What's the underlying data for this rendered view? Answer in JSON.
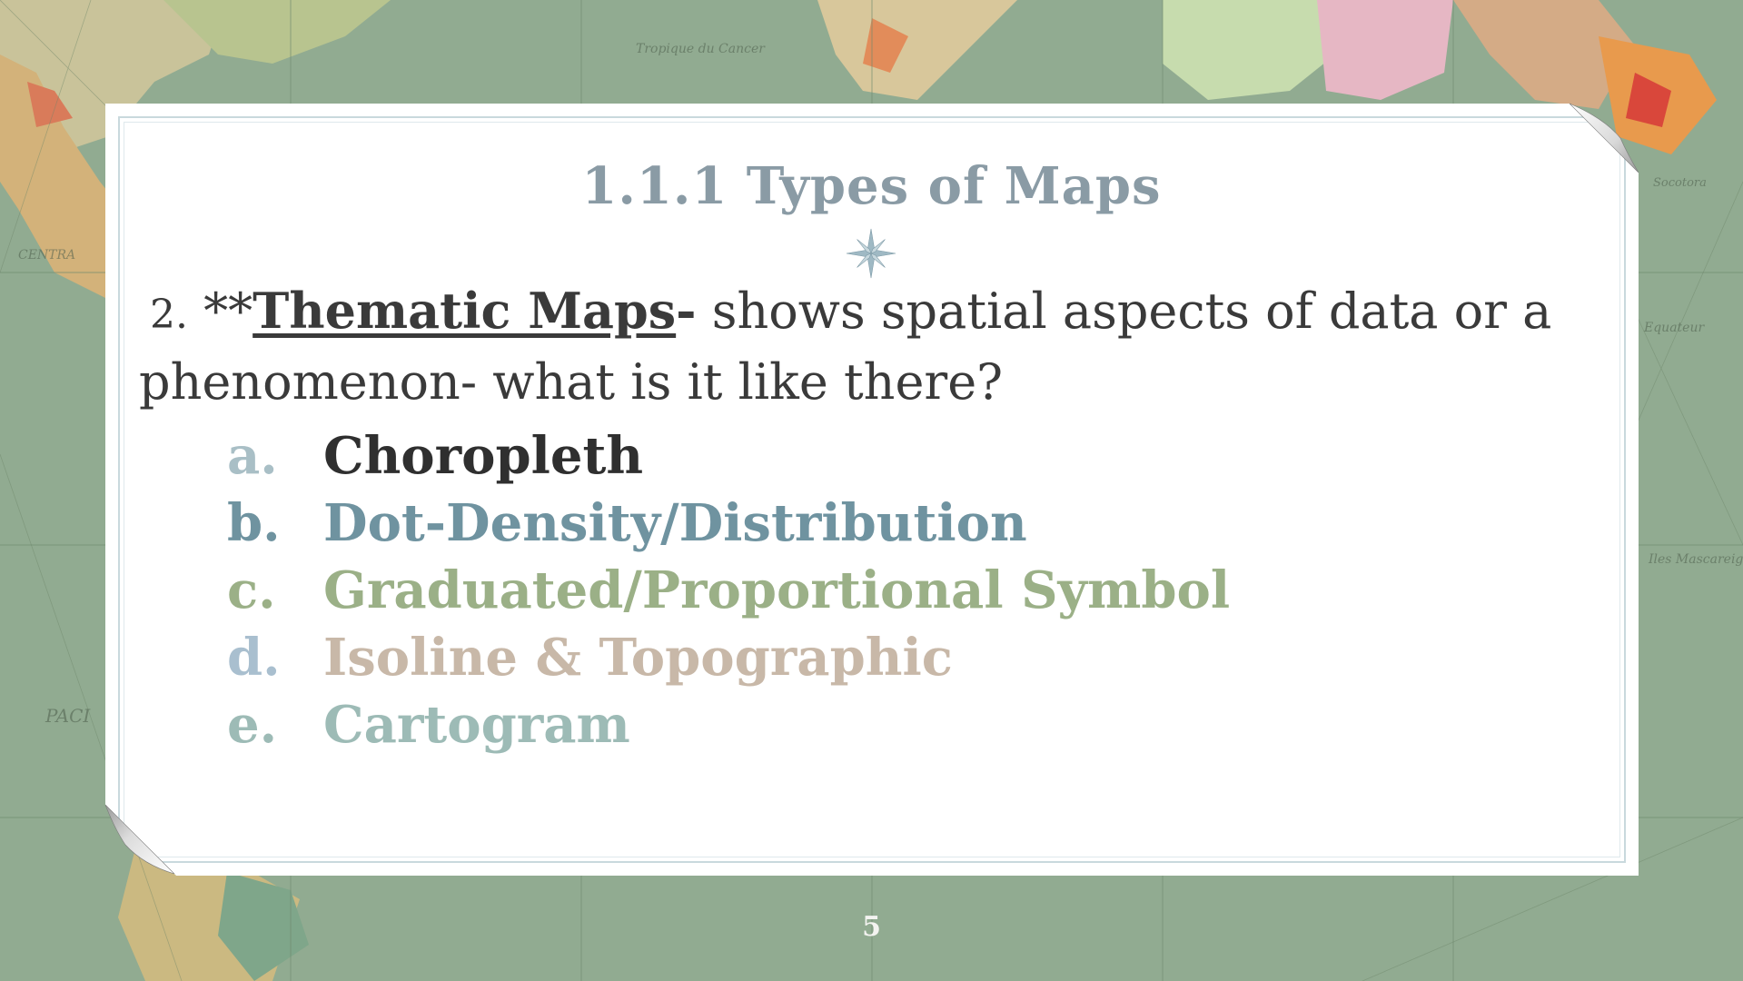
{
  "slide": {
    "title": "1.1.1 Types of Maps",
    "intro": {
      "number": "2.",
      "asterisks": "**",
      "term": "Thematic Maps",
      "dash": "-",
      "text_line1": " shows spatial aspects of data or a",
      "text_line2": "phenomenon- what is it like there?"
    },
    "list": [
      {
        "marker": "a.",
        "text": "Choropleth",
        "marker_color": "#a9bfc6",
        "text_color": "#2f2f2f"
      },
      {
        "marker": "b.",
        "text": "Dot-Density/Distribution",
        "marker_color": "#6f93a0",
        "text_color": "#6f93a0"
      },
      {
        "marker": "c.",
        "text": "Graduated/Proportional Symbol",
        "marker_color": "#9bb087",
        "text_color": "#9bb087"
      },
      {
        "marker": "d.",
        "text": "Isoline & Topographic",
        "marker_color": "#a9bfcf",
        "text_color": "#c8b8a8"
      },
      {
        "marker": "e.",
        "text": "Cartogram",
        "marker_color": "#9dbbb6",
        "text_color": "#9dbbb6"
      }
    ],
    "page_number": "5"
  }
}
